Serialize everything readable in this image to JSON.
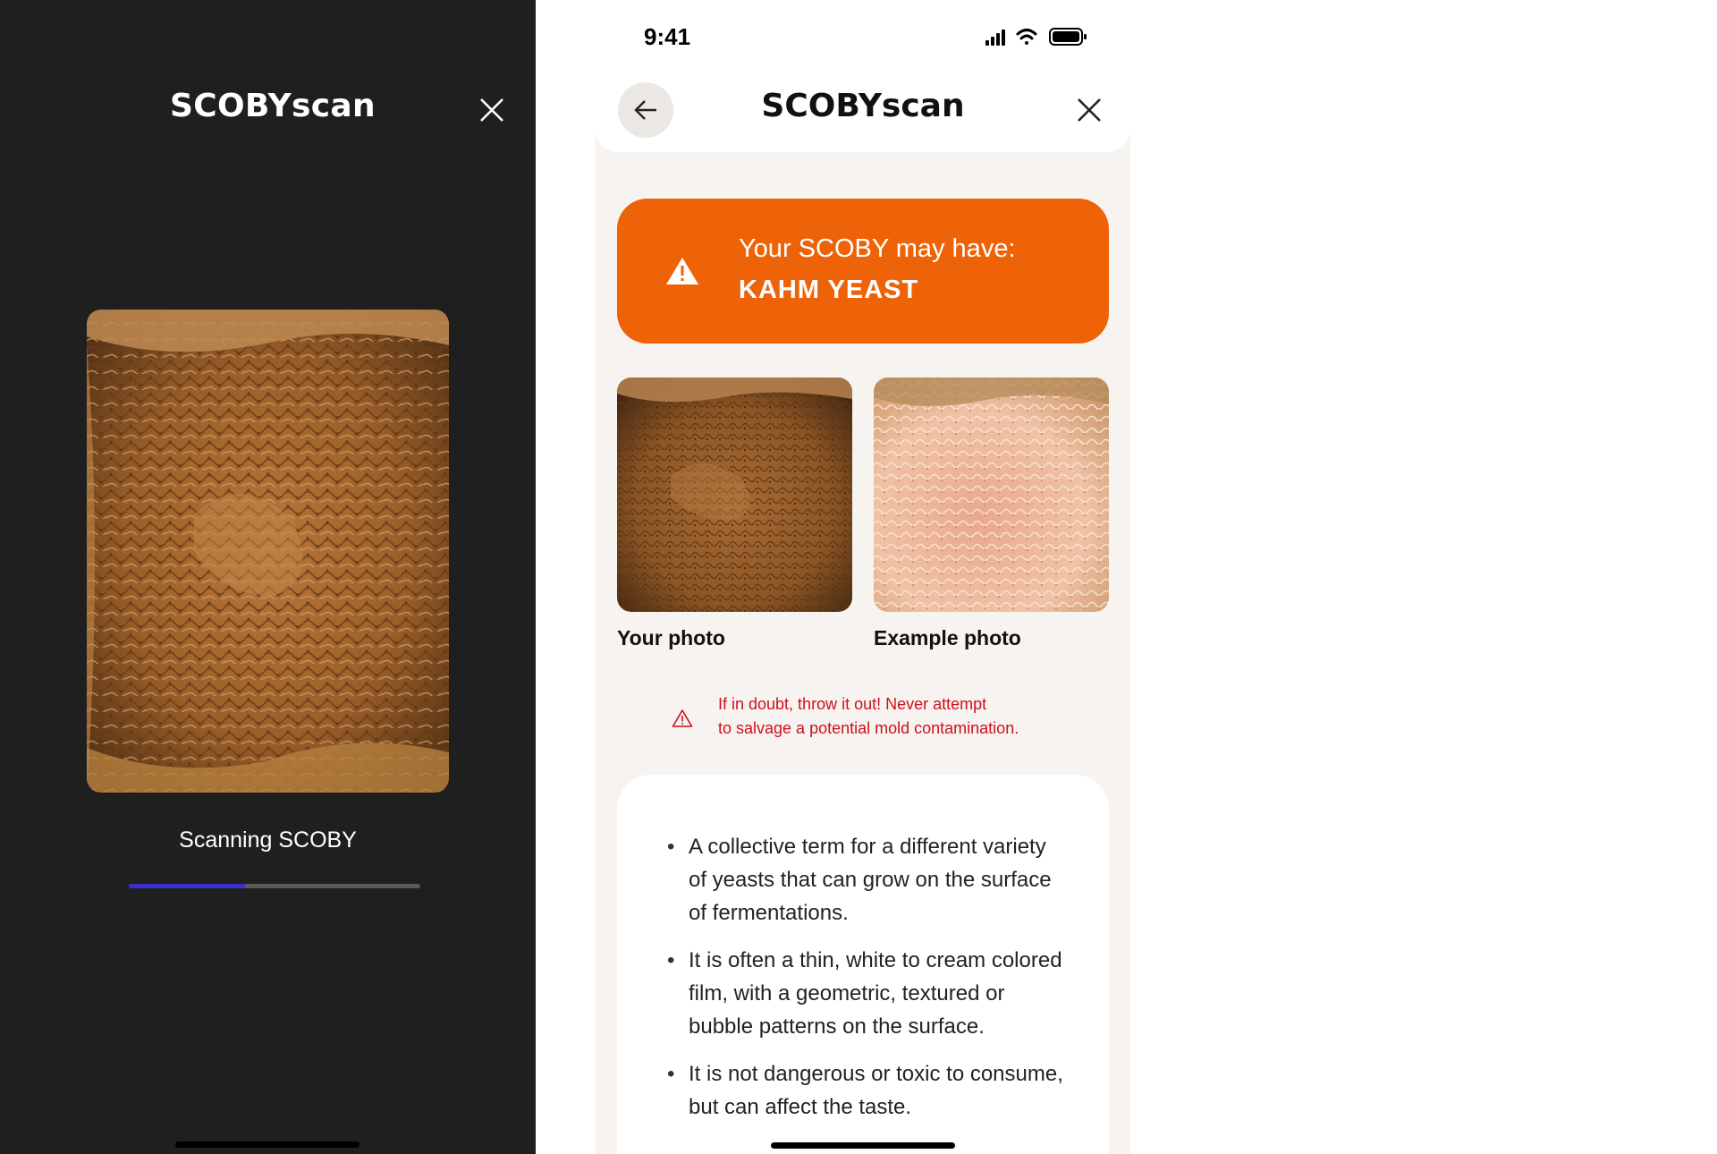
{
  "scan_screen": {
    "title": "SCOBYscan",
    "status": "Scanning SCOBY",
    "progress": 0.4
  },
  "result_screen": {
    "status_bar": {
      "time": "9:41"
    },
    "title": "SCOBYscan",
    "alert": {
      "line1": "Your SCOBY may have:",
      "line2": "KAHM YEAST",
      "color": "#ee6308"
    },
    "photos": {
      "yours_label": "Your photo",
      "example_label": "Example photo"
    },
    "warning": {
      "line1": "If in doubt, throw it out! Never attempt",
      "line2": "to salvage a potential mold contamination."
    },
    "bullets": [
      "A collective term for a different variety of yeasts that can grow on the surface of fermentations.",
      "It is often a thin, white to cream colored film, with a geometric, textured or bubble patterns on the surface.",
      "It is not dangerous or toxic to consume, but can affect the taste."
    ]
  },
  "icons": {
    "close": "close-icon",
    "back": "arrow-left-icon",
    "warning": "warning-triangle-icon",
    "signal": "cellular-signal-icon",
    "wifi": "wifi-icon",
    "battery": "battery-icon"
  },
  "colors": {
    "progress": "#3b2ed0",
    "dark_bg": "#1f1f1f",
    "warning_red": "#d00f1e"
  }
}
